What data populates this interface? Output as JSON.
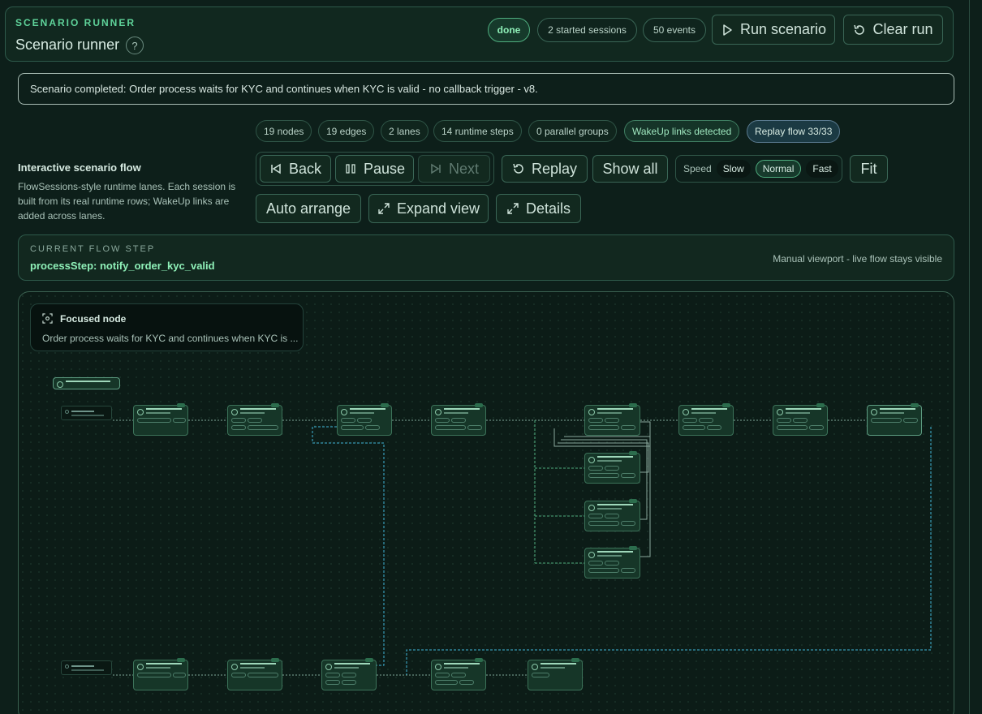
{
  "header": {
    "eyebrow": "SCENARIO RUNNER",
    "title": "Scenario runner",
    "help": "?",
    "status": "done",
    "sessions": "2 started sessions",
    "events": "50 events",
    "run_label": "Run scenario",
    "clear_label": "Clear run"
  },
  "banner": "Scenario completed: Order process waits for KYC and continues when KYC is valid - no callback trigger - v8.",
  "stats": [
    "19 nodes",
    "19 edges",
    "2 lanes",
    "14 runtime steps",
    "0 parallel groups",
    "WakeUp links detected",
    "Replay flow 33/33"
  ],
  "flow": {
    "title": "Interactive scenario flow",
    "description": "FlowSessions-style runtime lanes. Each session is built from its real runtime rows; WakeUp links are added across lanes."
  },
  "controls": {
    "back": "Back",
    "pause": "Pause",
    "next": "Next",
    "replay": "Replay",
    "show_all": "Show all",
    "speed_label": "Speed",
    "speed_options": [
      "Slow",
      "Normal",
      "Fast"
    ],
    "speed_selected": "Normal",
    "fit": "Fit",
    "auto_arrange": "Auto arrange",
    "expand_view": "Expand view",
    "details": "Details"
  },
  "current_step": {
    "label": "CURRENT FLOW STEP",
    "value": "processStep: notify_order_kyc_valid",
    "viewport_note": "Manual viewport - live flow stays visible"
  },
  "focused_node": {
    "title": "Focused node",
    "description": "Order process waits for KYC and continues when KYC is ..."
  }
}
